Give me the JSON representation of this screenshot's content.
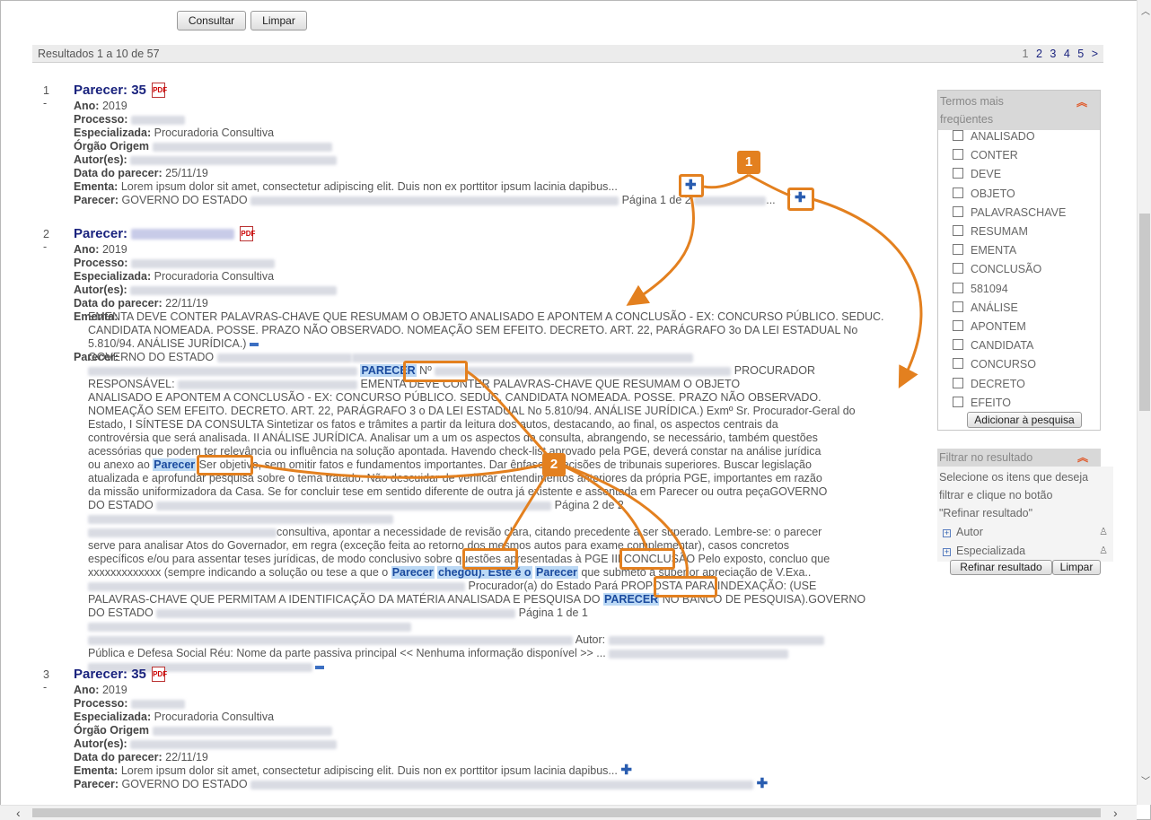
{
  "form": {
    "consultar": "Consultar",
    "limpar": "Limpar"
  },
  "results_bar": {
    "text": "Resultados 1 a 10 de 57",
    "current_page": "1",
    "pages": [
      "2",
      "3",
      "4",
      "5"
    ],
    "next": ">"
  },
  "labels": {
    "ano": "Ano:",
    "processo": "Processo:",
    "especializada": "Especializada:",
    "orgao": "Órgão Origem",
    "autor": "Autor(es):",
    "data": "Data do parecer:",
    "ementa": "Ementa:",
    "parecer": "Parecer:"
  },
  "results": [
    {
      "index": "1 -",
      "title": "Parecer: 35",
      "ano": "2019",
      "especializada": "Procuradoria Consultiva",
      "data": "25/11/19",
      "ementa": "Lorem ipsum dolor sit amet, consectetur adipiscing elit. Duis non ex porttitor ipsum lacinia dapibus...",
      "parecer_start": "GOVERNO DO ESTADO",
      "pagina": "Página 1 de 2",
      "ellipsis": "..."
    },
    {
      "index": "2 -",
      "title": "Parecer:",
      "ano": "2019",
      "especializada": "Procuradoria Consultiva",
      "data": "22/11/19",
      "ementa_lines": [
        "EMENTA DEVE CONTER PALAVRAS-CHAVE QUE RESUMAM O OBJETO ANALISADO E APONTEM A CONCLUSÃO - EX: CONCURSO PÚBLICO. SEDUC.",
        "CANDIDATA NOMEADA. POSSE. PRAZO NÃO OBSERVADO. NOMEAÇÃO SEM EFEITO. DECRETO. ART. 22, PARÁGRAFO 3o DA LEI ESTADUAL No",
        "5.810/94. ANÁLISE JURÍDICA.)"
      ],
      "parecer_lines": [
        "GOVERNO DO ESTADO",
        "PROCURADOR",
        "RESPONSÁVEL:",
        "EMENTA DEVE CONTER PALAVRAS-CHAVE QUE RESUMAM O OBJETO",
        "ANALISADO E APONTEM A CONCLUSÃO - EX: CONCURSO PÚBLICO. SEDUC. CANDIDATA NOMEADA. POSSE. PRAZO NÃO OBSERVADO.",
        "NOMEAÇÃO SEM EFEITO. DECRETO. ART. 22, PARÁGRAFO 3 o DA LEI ESTADUAL No 5.810/94. ANÁLISE JURÍDICA.) Exmº Sr. Procurador-Geral do",
        "Estado, I SÍNTESE DA CONSULTA Sintetizar os fatos e trâmites a partir da leitura dos autos, destacando, ao final, os aspectos centrais da",
        "controvérsia que será analisada. II ANÁLISE JURÍDICA. Analisar um a um os aspectos da consulta, abrangendo, se necessário, também questões",
        "acessórias que podem ter relevância ou influência na solução apontada. Havendo check-list aprovado pela PGE, deverá constar na análise jurídica",
        "ou anexo ao",
        "Ser objetivo, sem omitir fatos e fundamentos importantes. Dar ênfase a decisões de tribunais superiores. Buscar legislação",
        "atualizada e aprofundar pesquisa sobre o tema tratado. Não descuidar de verificar entendimentos anteriores da própria PGE, importantes em razão",
        "da missão uniformizadora da Casa. Se for concluir tese em sentido diferente de outra já existente e assentada em Parecer ou outra peçaGOVERNO",
        "DO ESTADO",
        "Página 2 de 2",
        "consultiva, apontar a necessidade de revisão clara, citando precedente a ser superado. Lembre-se: o parecer",
        "serve para analisar Atos do Governador, em regra (exceção feita ao retorno dos mesmos autos para exame complementar), casos concretos",
        "específicos e/ou para assentar teses jurídicas, de modo conclusivo sobre questões apresentadas à PGE III CONCLUSÃO Pelo exposto, concluo que",
        "xxxxxxxxxxxxx (sempre indicando a solução ou tese a que o",
        "chegou). Este é o",
        "que submeto à superior apreciação de V.Exa..",
        "Procurador(a) do Estado Pará PROPOSTA PARA INDEXAÇÃO: (USE",
        "PALAVRAS-CHAVE QUE PERMITAM A IDENTIFICAÇÃO DA MATÉRIA ANALISADA E PESQUISA DO",
        "NO BANCO DE PESQUISA).GOVERNO",
        "DO ESTADO",
        "Página 1 de 1",
        "Autor:",
        "Pública e Defesa Social Réu: Nome da parte passiva principal << Nenhuma informação disponível >> ..."
      ],
      "hl_upper": "PARECER",
      "hl_lower": "Parecer",
      "nº": "Nº"
    },
    {
      "index": "3 -",
      "title": "Parecer: 35",
      "ano": "2019",
      "especializada": "Procuradoria Consultiva",
      "data": "22/11/19",
      "ementa": "Lorem ipsum dolor sit amet, consectetur adipiscing elit. Duis non ex porttitor ipsum lacinia dapibus...",
      "parecer_start": "GOVERNO DO ESTADO"
    }
  ],
  "annotations": {
    "badge1": "1",
    "badge2": "2"
  },
  "terms_panel": {
    "title_l1": "Termos mais",
    "title_l2": "freqüentes",
    "items": [
      "ANALISADO",
      "CONTER",
      "DEVE",
      "OBJETO",
      "PALAVRASCHAVE",
      "RESUMAM",
      "EMENTA",
      "CONCLUSÃO",
      "581094",
      "ANÁLISE",
      "APONTEM",
      "CANDIDATA",
      "CONCURSO",
      "DECRETO",
      "EFEITO"
    ],
    "add_button": "Adicionar à pesquisa"
  },
  "filter_panel": {
    "title": "Filtrar no resultado",
    "desc_lines": [
      "Selecione os itens que deseja",
      "filtrar e clique no botão",
      "\"Refinar resultado\""
    ],
    "facets": [
      "Autor",
      "Especializada"
    ],
    "refine_button": "Refinar resultado",
    "clear_button": "Limpar"
  },
  "colors": {
    "accent": "#e3801f",
    "title": "#1a237e",
    "highlight": "#bcd9f5"
  }
}
